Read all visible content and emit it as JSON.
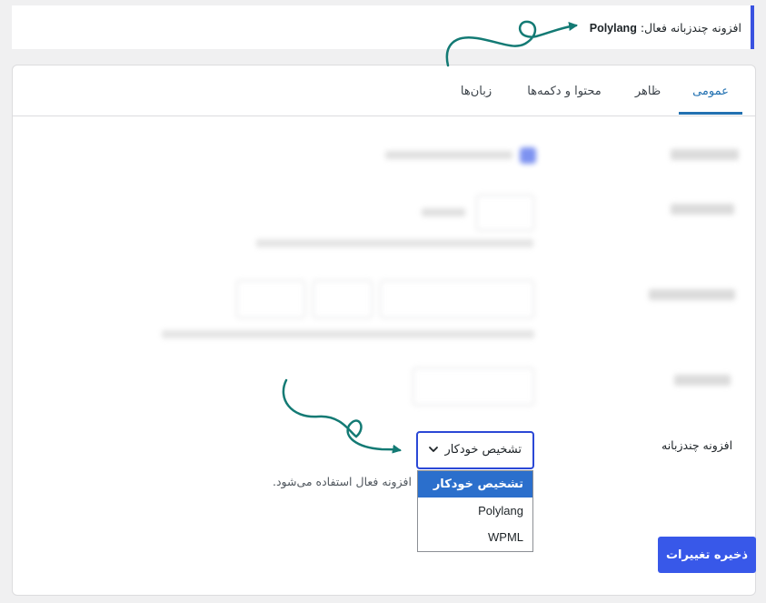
{
  "notice": {
    "prefix": "افزونه چندزبانه فعال:",
    "plugin": "Polylang"
  },
  "tabs": [
    {
      "label": "عمومی",
      "active": true
    },
    {
      "label": "ظاهر",
      "active": false
    },
    {
      "label": "محتوا و دکمه‌ها",
      "active": false
    },
    {
      "label": "زبان‌ها",
      "active": false
    }
  ],
  "settings": {
    "multilang_label": "افزونه چندزبانه",
    "selected": "تشخیص خودکار",
    "options": [
      "تشخیص خودکار",
      "Polylang",
      "WPML"
    ],
    "description": "افزونه فعال استفاده می‌شود."
  },
  "save_label": "ذخیره تغییرات",
  "colors": {
    "accent": "#2271b1",
    "button": "#3858e9",
    "arrow": "#137a74",
    "notice_border": "#3a52e0"
  }
}
